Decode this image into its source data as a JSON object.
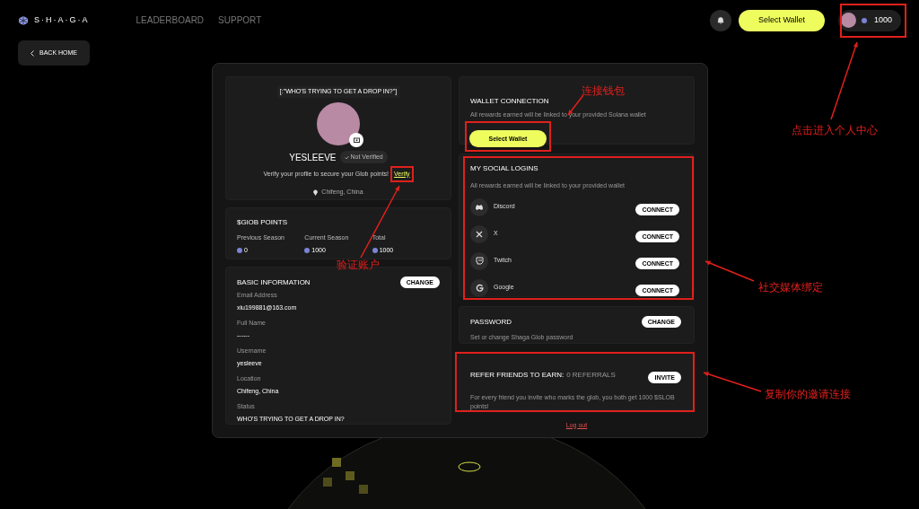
{
  "header": {
    "logo": "S·H·A·G·A",
    "nav": [
      "LEADERBOARD",
      "SUPPORT"
    ],
    "wallet_button": "Select Wallet",
    "points": "1000"
  },
  "back_button": "BACK HOME",
  "profile": {
    "status": "[:\"WHO'S TRYING TO GET A DROP IN?\"]",
    "name": "YESLEEVE",
    "verified": false,
    "verified_label": "Not Verified",
    "verify_text": "Verify your profile to secure your Glob points!",
    "verify_link": "Verify",
    "location": "Chifeng, China"
  },
  "points": {
    "title": "$GlOB POINTS",
    "items": [
      {
        "label": "Previous Season",
        "value": "0"
      },
      {
        "label": "Current Season",
        "value": "1000"
      },
      {
        "label": "Total",
        "value": "1000"
      }
    ]
  },
  "basic_info": {
    "title": "BASIC INFORMATION",
    "button": "CHANGE",
    "fields": [
      {
        "label": "Email Address",
        "value": "xiu199881@163.com"
      },
      {
        "label": "Full Name",
        "value": "------"
      },
      {
        "label": "Username",
        "value": "yesleeve"
      },
      {
        "label": "Location",
        "value": "Chifeng, China"
      },
      {
        "label": "Status",
        "value": "WHO'S TRYING TO GET A DROP IN?"
      }
    ]
  },
  "wallet": {
    "title": "WALLET CONNECTION",
    "description": "All rewards earned will be linked to your provided Solana wallet",
    "button": "Select Wallet"
  },
  "socials": {
    "title": "MY SOCIAL LOGINS",
    "description": "All rewards earned will be linked to your provided wallet",
    "items": [
      {
        "kind": "discord",
        "name": "Discord",
        "button": "CONNECT"
      },
      {
        "kind": "x",
        "name": "X",
        "button": "CONNECT"
      },
      {
        "kind": "twitch",
        "name": "Twitch",
        "button": "CONNECT"
      },
      {
        "kind": "google",
        "name": "Google",
        "button": "CONNECT"
      }
    ]
  },
  "password": {
    "title": "PASSWORD",
    "description": "Set or change Shaga Glob password",
    "button": "CHANGE"
  },
  "referral": {
    "title": "REFER FRIENDS TO EARN:",
    "count": "0 REFERRALS",
    "description": "For every friend you invite who marks the glob, you both get 1000 $SLOB points!",
    "button": "INVITE"
  },
  "logout": "Log out",
  "annotations": [
    "连接钱包",
    "点击进入个人中心",
    "验证账户",
    "社交媒体绑定",
    "复制你的邀请连接"
  ]
}
